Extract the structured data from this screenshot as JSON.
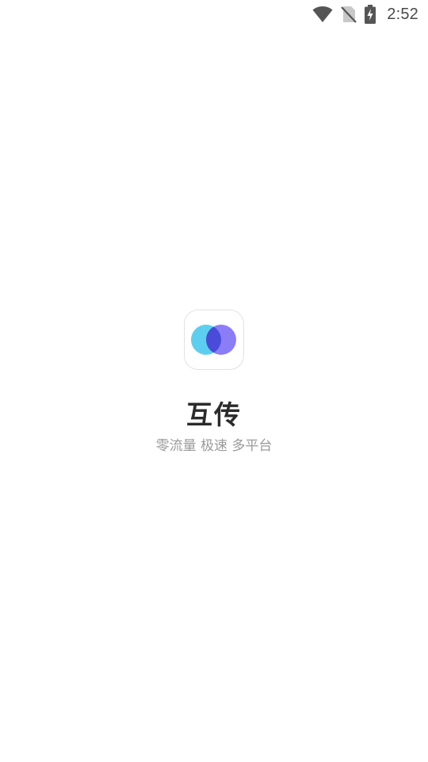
{
  "status_bar": {
    "time": "2:52",
    "icons": [
      "wifi-icon",
      "no-sim-icon",
      "battery-charging-icon"
    ]
  },
  "app": {
    "icon": "overlapping-circles-logo",
    "name": "互传",
    "tagline": "零流量 极速 多平台"
  },
  "colors": {
    "logo_left": "#5ccff0",
    "logo_right": "#8a7df6",
    "logo_overlap": "#4a4bd9",
    "background": "#ffffff"
  }
}
